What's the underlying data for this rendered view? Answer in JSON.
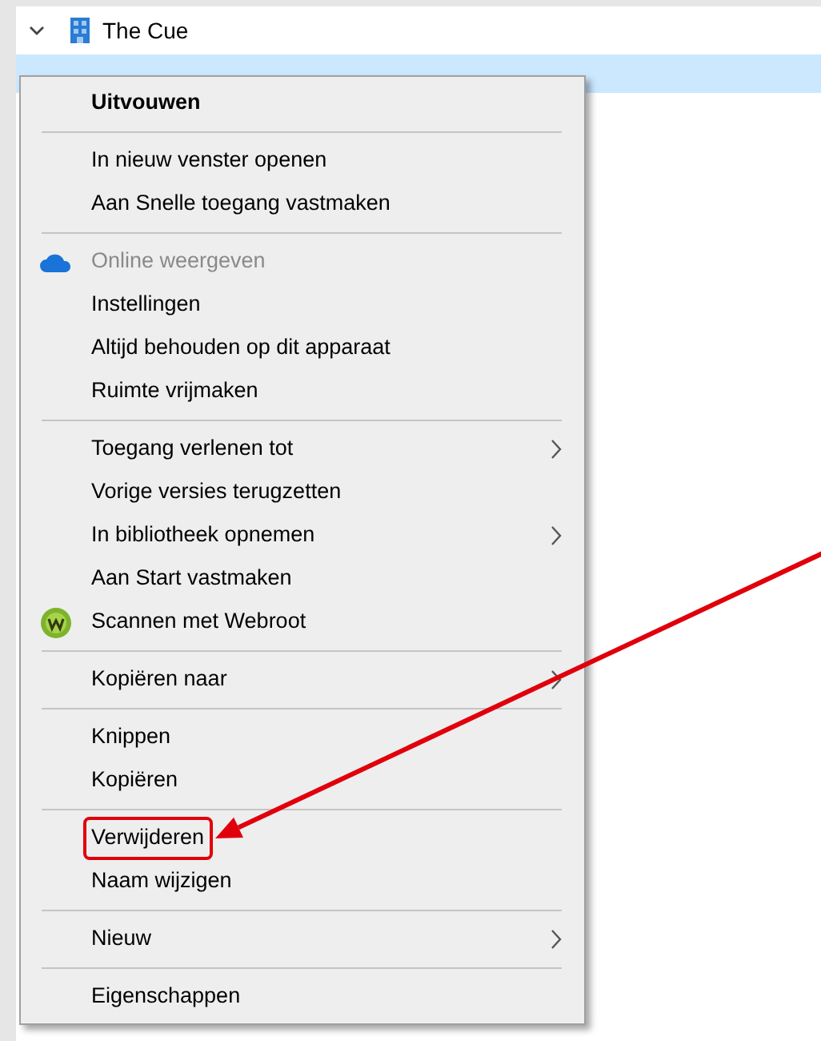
{
  "tree": {
    "expanded": true,
    "label": "The Cue",
    "selected_row": true
  },
  "context_menu": {
    "groups": [
      {
        "items": [
          {
            "label": "Uitvouwen",
            "kind": "plain",
            "default": true,
            "disabled": false,
            "submenu": false,
            "highlighted": false
          }
        ]
      },
      {
        "items": [
          {
            "label": "In nieuw venster openen",
            "kind": "plain",
            "default": false,
            "disabled": false,
            "submenu": false,
            "highlighted": false
          },
          {
            "label": "Aan Snelle toegang vastmaken",
            "kind": "plain",
            "default": false,
            "disabled": false,
            "submenu": false,
            "highlighted": false
          }
        ]
      },
      {
        "items": [
          {
            "label": "Online weergeven",
            "kind": "cloud",
            "default": false,
            "disabled": true,
            "submenu": false,
            "highlighted": false
          },
          {
            "label": "Instellingen",
            "kind": "plain",
            "default": false,
            "disabled": false,
            "submenu": false,
            "highlighted": false
          },
          {
            "label": "Altijd behouden op dit apparaat",
            "kind": "plain",
            "default": false,
            "disabled": false,
            "submenu": false,
            "highlighted": false
          },
          {
            "label": "Ruimte vrijmaken",
            "kind": "plain",
            "default": false,
            "disabled": false,
            "submenu": false,
            "highlighted": false
          }
        ]
      },
      {
        "items": [
          {
            "label": "Toegang verlenen tot",
            "kind": "plain",
            "default": false,
            "disabled": false,
            "submenu": true,
            "highlighted": false
          },
          {
            "label": "Vorige versies terugzetten",
            "kind": "plain",
            "default": false,
            "disabled": false,
            "submenu": false,
            "highlighted": false
          },
          {
            "label": "In bibliotheek opnemen",
            "kind": "plain",
            "default": false,
            "disabled": false,
            "submenu": true,
            "highlighted": false
          },
          {
            "label": "Aan Start vastmaken",
            "kind": "plain",
            "default": false,
            "disabled": false,
            "submenu": false,
            "highlighted": false
          },
          {
            "label": "Scannen met Webroot",
            "kind": "webroot",
            "default": false,
            "disabled": false,
            "submenu": false,
            "highlighted": false
          }
        ]
      },
      {
        "items": [
          {
            "label": "Kopiëren naar",
            "kind": "plain",
            "default": false,
            "disabled": false,
            "submenu": true,
            "highlighted": false
          }
        ]
      },
      {
        "items": [
          {
            "label": "Knippen",
            "kind": "plain",
            "default": false,
            "disabled": false,
            "submenu": false,
            "highlighted": false
          },
          {
            "label": "Kopiëren",
            "kind": "plain",
            "default": false,
            "disabled": false,
            "submenu": false,
            "highlighted": false
          }
        ]
      },
      {
        "items": [
          {
            "label": "Verwijderen",
            "kind": "plain",
            "default": false,
            "disabled": false,
            "submenu": false,
            "highlighted": true
          },
          {
            "label": "Naam wijzigen",
            "kind": "plain",
            "default": false,
            "disabled": false,
            "submenu": false,
            "highlighted": false
          }
        ]
      },
      {
        "items": [
          {
            "label": "Nieuw",
            "kind": "plain",
            "default": false,
            "disabled": false,
            "submenu": true,
            "highlighted": false
          }
        ]
      },
      {
        "items": [
          {
            "label": "Eigenschappen",
            "kind": "plain",
            "default": false,
            "disabled": false,
            "submenu": false,
            "highlighted": false
          }
        ]
      }
    ]
  },
  "annotation_arrow": true
}
